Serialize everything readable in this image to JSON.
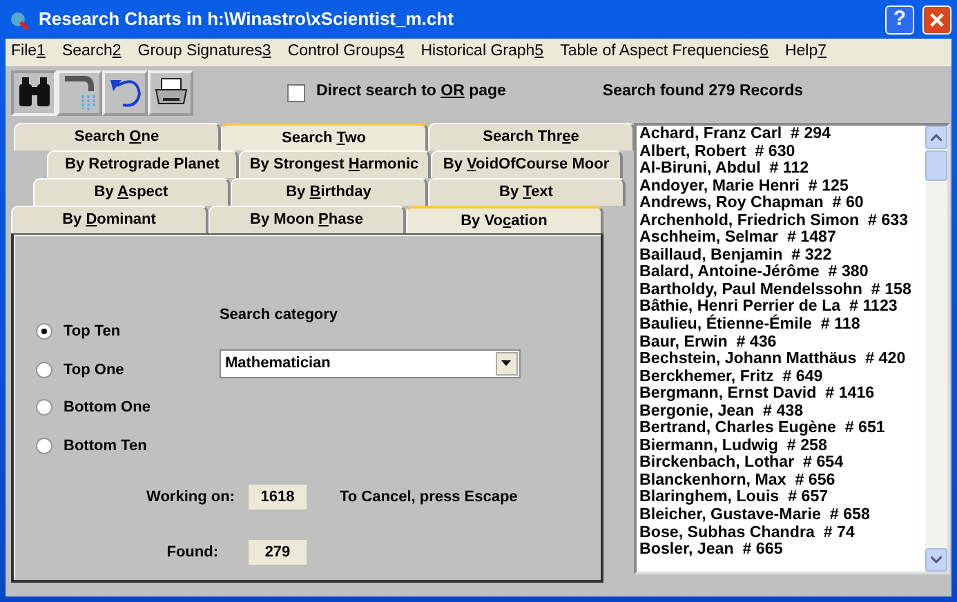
{
  "window": {
    "title": "Research Charts in h:\\Winastro\\xScientist_m.cht",
    "help_button": "?"
  },
  "menu": [
    {
      "label": [
        {
          "text": "File",
          "underline": false
        },
        {
          "text": "1",
          "underline": true
        }
      ]
    },
    {
      "label": [
        {
          "text": "Search",
          "underline": false
        },
        {
          "text": "2",
          "underline": true
        }
      ]
    },
    {
      "label": [
        {
          "text": "Group Signatures",
          "underline": false
        },
        {
          "text": "3",
          "underline": true
        }
      ]
    },
    {
      "label": [
        {
          "text": "Control Groups",
          "underline": false
        },
        {
          "text": "4",
          "underline": true
        }
      ]
    },
    {
      "label": [
        {
          "text": "Historical Graph",
          "underline": false
        },
        {
          "text": "5",
          "underline": true
        }
      ]
    },
    {
      "label": [
        {
          "text": "Table of Aspect Frequencies",
          "underline": false
        },
        {
          "text": "6",
          "underline": true
        }
      ]
    },
    {
      "label": [
        {
          "text": "Help",
          "underline": false
        },
        {
          "text": "7",
          "underline": true
        }
      ]
    }
  ],
  "toolbar": {
    "tools": [
      {
        "kind": "binoculars",
        "pressed": true
      },
      {
        "kind": "tap",
        "pressed": false
      },
      {
        "kind": "undo",
        "pressed": false
      },
      {
        "kind": "print",
        "pressed": false
      }
    ],
    "direct_search": {
      "checked": false,
      "label": [
        {
          "text": "Direct search to ",
          "underline": false
        },
        {
          "text": "OR",
          "underline": true
        },
        {
          "text": " page",
          "underline": false
        }
      ]
    },
    "status": "Search found 279 Records"
  },
  "search_tabs": [
    {
      "selected": false,
      "label": [
        {
          "text": "Search ",
          "underline": false
        },
        {
          "text": "O",
          "underline": true
        },
        {
          "text": "ne",
          "underline": false
        }
      ]
    },
    {
      "selected": true,
      "label": [
        {
          "text": "Search ",
          "underline": false
        },
        {
          "text": "T",
          "underline": true
        },
        {
          "text": "wo",
          "underline": false
        }
      ]
    },
    {
      "selected": false,
      "label": [
        {
          "text": "Search Thr",
          "underline": false
        },
        {
          "text": "e",
          "underline": true
        },
        {
          "text": "e",
          "underline": false
        }
      ]
    }
  ],
  "category_tab_rows": [
    [
      {
        "selected": false,
        "label": [
          {
            "text": "By Retrograde Planet",
            "underline": false
          }
        ]
      },
      {
        "selected": false,
        "label": [
          {
            "text": "By Strongest ",
            "underline": false
          },
          {
            "text": "H",
            "underline": true
          },
          {
            "text": "armonic",
            "underline": false
          }
        ]
      },
      {
        "selected": false,
        "label": [
          {
            "text": "By ",
            "underline": false
          },
          {
            "text": "V",
            "underline": true
          },
          {
            "text": "oidOfCourse Moor",
            "underline": false
          }
        ]
      }
    ],
    [
      {
        "selected": false,
        "label": [
          {
            "text": "By ",
            "underline": false
          },
          {
            "text": "A",
            "underline": true
          },
          {
            "text": "spect",
            "underline": false
          }
        ]
      },
      {
        "selected": false,
        "label": [
          {
            "text": "By ",
            "underline": false
          },
          {
            "text": "B",
            "underline": true
          },
          {
            "text": "irthday",
            "underline": false
          }
        ]
      },
      {
        "selected": false,
        "label": [
          {
            "text": "By ",
            "underline": false
          },
          {
            "text": "T",
            "underline": true
          },
          {
            "text": "ext",
            "underline": false
          }
        ]
      }
    ],
    [
      {
        "selected": false,
        "label": [
          {
            "text": "By ",
            "underline": false
          },
          {
            "text": "D",
            "underline": true
          },
          {
            "text": "ominant",
            "underline": false
          }
        ]
      },
      {
        "selected": false,
        "label": [
          {
            "text": "By Moon ",
            "underline": false
          },
          {
            "text": "P",
            "underline": true
          },
          {
            "text": "hase",
            "underline": false
          }
        ]
      },
      {
        "selected": true,
        "label": [
          {
            "text": "By Vo",
            "underline": false
          },
          {
            "text": "c",
            "underline": true
          },
          {
            "text": "ation",
            "underline": false
          }
        ]
      }
    ]
  ],
  "options": [
    {
      "label": "Top Ten",
      "selected": true
    },
    {
      "label": "Top One",
      "selected": false
    },
    {
      "label": "Bottom One",
      "selected": false
    },
    {
      "label": "Bottom Ten",
      "selected": false
    }
  ],
  "search_category": {
    "label": "Search category",
    "value": "Mathematician"
  },
  "working_on": {
    "label": "Working on:",
    "value": "1618",
    "hint": "To Cancel, press Escape"
  },
  "found": {
    "label": "Found:",
    "value": "279"
  },
  "records": [
    "Achard, Franz Carl  # 294",
    "Albert, Robert  # 630",
    "Al-Biruni, Abdul  # 112",
    "Andoyer, Marie Henri  # 125",
    "Andrews, Roy Chapman  # 60",
    "Archenhold, Friedrich Simon  # 633",
    "Aschheim, Selmar  # 1487",
    "Baillaud, Benjamin  # 322",
    "Balard, Antoine-Jérôme  # 380",
    "Bartholdy, Paul Mendelssohn  # 158",
    "Bâthie, Henri Perrier de La  # 1123",
    "Baulieu, Étienne-Émile  # 118",
    "Baur, Erwin  # 436",
    "Bechstein, Johann Matthäus  # 420",
    "Berckhemer, Fritz  # 649",
    "Bergmann, Ernst David  # 1416",
    "Bergonie, Jean  # 438",
    "Bertrand, Charles Eugène  # 651",
    "Biermann, Ludwig  # 258",
    "Birckenbach, Lothar  # 654",
    "Blanckenhorn, Max  # 656",
    "Blaringhem, Louis  # 657",
    "Bleicher, Gustave-Marie  # 658",
    "Bose, Subhas Chandra  # 74",
    "Bosler, Jean  # 665"
  ]
}
